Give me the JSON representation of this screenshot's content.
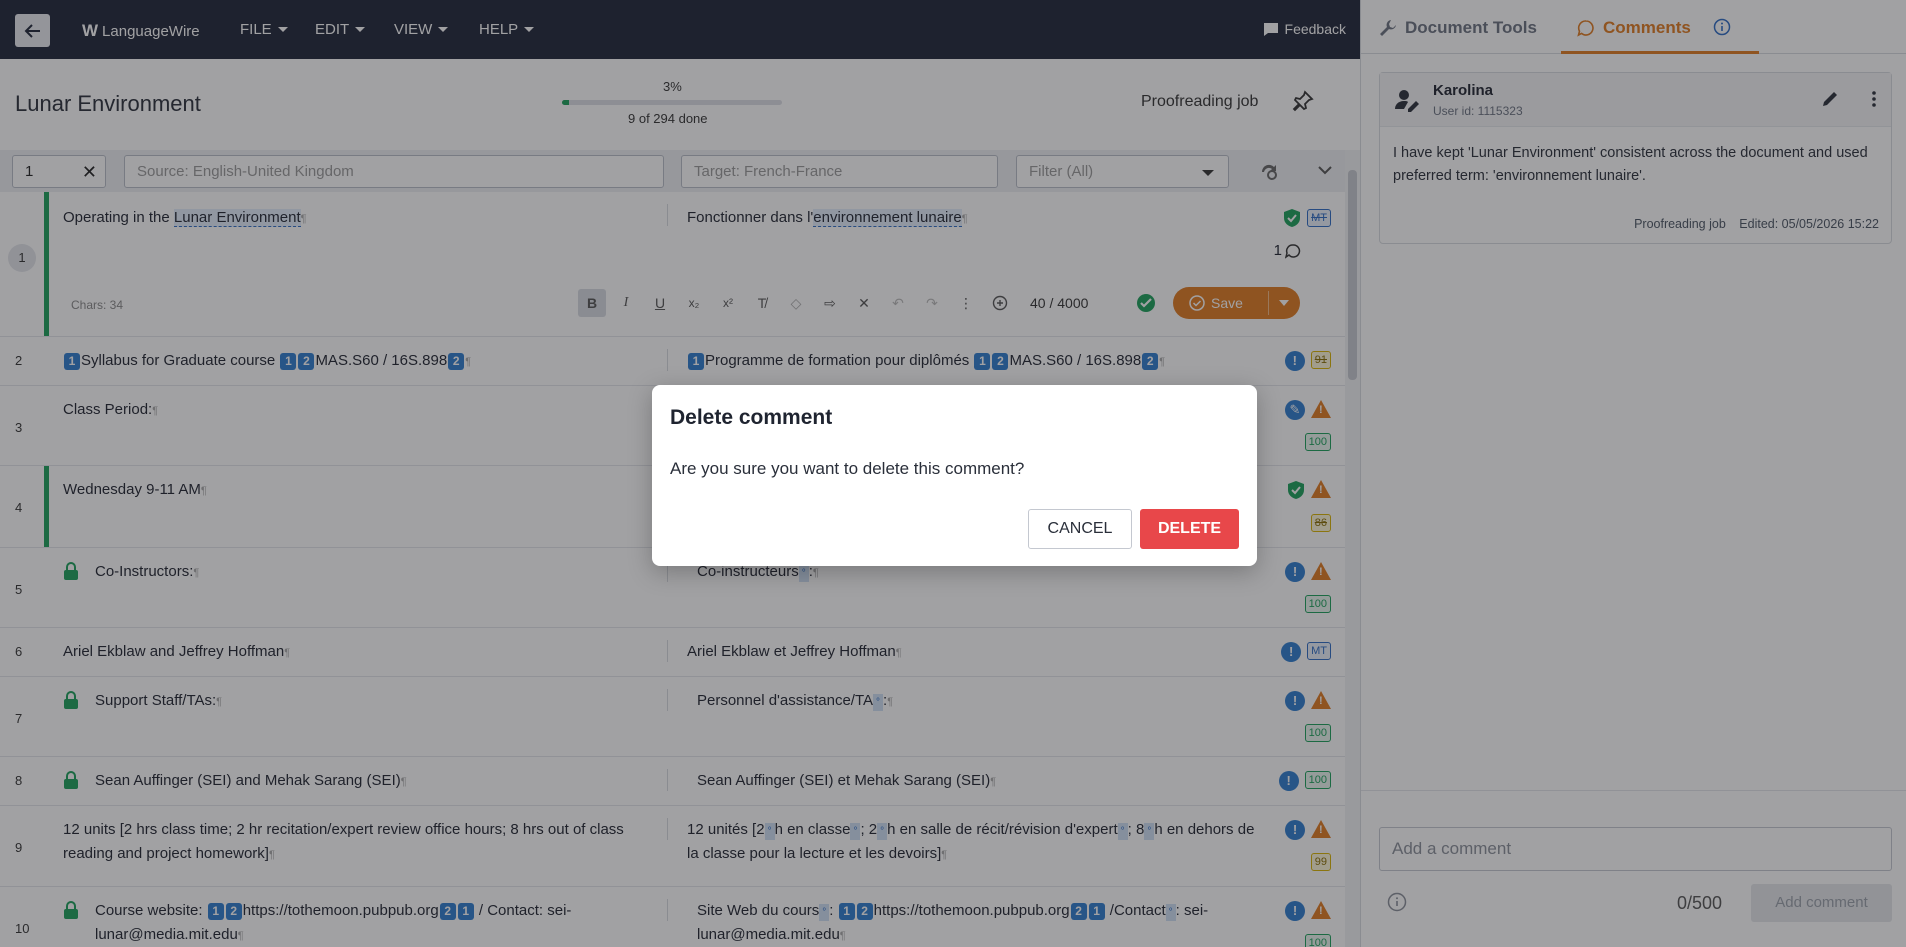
{
  "topbar": {
    "logo_text": "LanguageWire",
    "menus": [
      {
        "label": "FILE"
      },
      {
        "label": "EDIT"
      },
      {
        "label": "VIEW"
      },
      {
        "label": "HELP"
      }
    ],
    "feedback_label": "Feedback"
  },
  "document": {
    "title": "Lunar Environment",
    "progress_percent": "3%",
    "progress_value": 0.03,
    "progress_done": "9 of 294 done",
    "job_type": "Proofreading job"
  },
  "filters": {
    "segment_number": "1",
    "source_placeholder": "Source: English-United Kingdom",
    "target_placeholder": "Target: French-France",
    "filter_value": "Filter (All)"
  },
  "segments": [
    {
      "num": "1",
      "src_pre": "Operating in the ",
      "src_term": "Lunar Environment",
      "tgt_pre": "Fonctionner dans l'",
      "tgt_term": "environnement lunaire",
      "badge": "MT",
      "comment_count": "1"
    },
    {
      "num": "2",
      "src": "Syllabus for Graduate course ",
      "src2": "MAS.S60 / 16S.898",
      "tgt": "Programme de formation pour diplômés ",
      "tgt2": "MAS.S60 / 16S.898",
      "badge": "91"
    },
    {
      "num": "3",
      "src": "Class Period:",
      "badge": "100"
    },
    {
      "num": "4",
      "src": "Wednesday 9-11 AM",
      "badge": "86"
    },
    {
      "num": "5",
      "src": "Co-Instructors:",
      "tgt": "Co-instructeurs",
      "badge": "100"
    },
    {
      "num": "6",
      "src": "Ariel Ekblaw and Jeffrey Hoffman",
      "tgt": "Ariel Ekblaw et Jeffrey Hoffman",
      "badge": "MT"
    },
    {
      "num": "7",
      "src": "Support Staff/TAs:",
      "tgt": "Personnel d'assistance/TA",
      "badge": "100"
    },
    {
      "num": "8",
      "src": "Sean Auffinger (SEI) and Mehak Sarang (SEI)",
      "tgt": "Sean Auffinger (SEI) et Mehak Sarang (SEI)",
      "badge": "100"
    },
    {
      "num": "9",
      "src": "12 units [2 hrs class time; 2 hr recitation/expert review office hours; 8 hrs out of class reading and project homework]",
      "tgt_a": "12 unités [2",
      "tgt_b": "h en classe",
      "tgt_c": "; 2",
      "tgt_d": "h en salle de récit/révision d'expert",
      "tgt_e": "; 8",
      "tgt_f": "h en dehors de la classe pour la lecture et les devoirs]",
      "badge": "99"
    },
    {
      "num": "10",
      "src_pre": "Course website: ",
      "src_url": "https://tothemoon.pubpub.org",
      "src_post": " / Contact: sei-lunar@media.mit.edu",
      "tgt_pre": "Site Web du cours",
      "tgt_url": "https://tothemoon.pubpub.org",
      "tgt_post1": " /Contact",
      "tgt_post2": ": sei-lunar@media.mit.edu",
      "badge": "100"
    }
  ],
  "active_segment": {
    "chars": "Chars: 34",
    "char_count": "40 / 4000",
    "save_label": "Save"
  },
  "panel": {
    "tab_tools": "Document Tools",
    "tab_comments": "Comments",
    "comment": {
      "author": "Karolina",
      "user_id": "User id: 1115323",
      "text": "I have kept 'Lunar Environment' consistent across the document and used preferred term: 'environnement lunaire'.",
      "job": "Proofreading job",
      "edited": "Edited: 05/05/2026 15:22"
    },
    "add_placeholder": "Add a comment",
    "counter": "0/500",
    "add_button": "Add comment"
  },
  "dialog": {
    "title": "Delete comment",
    "message": "Are you sure you want to delete this comment?",
    "cancel": "CANCEL",
    "delete": "DELETE"
  },
  "colors": {
    "topbar": "#1e2538",
    "accent": "#e07a1f",
    "danger": "#e8474a",
    "confirmed": "#1aa05a",
    "tag": "#2d7ccf"
  }
}
